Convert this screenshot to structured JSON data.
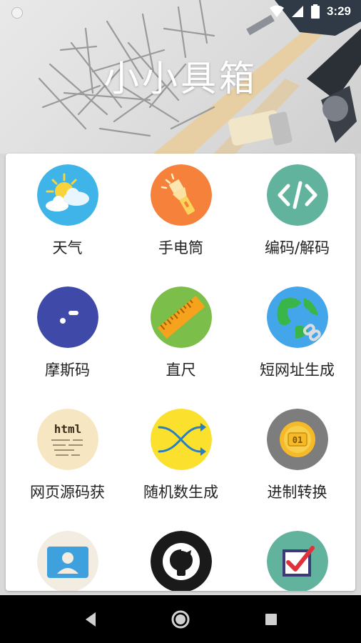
{
  "status_bar": {
    "time": "3:29"
  },
  "header": {
    "title": "小小具箱"
  },
  "tools": [
    {
      "label": "天气",
      "icon": "weather-icon",
      "color": "#3fb4e8"
    },
    {
      "label": "手电筒",
      "icon": "flashlight-icon",
      "color": "#f5813a"
    },
    {
      "label": "编码/解码",
      "icon": "code-icon",
      "color": "#62b39e"
    },
    {
      "label": "摩斯码",
      "icon": "morse-icon",
      "color": "#3f4aa8"
    },
    {
      "label": "直尺",
      "icon": "ruler-icon",
      "color": "#7cbe4a"
    },
    {
      "label": "短网址生成",
      "icon": "globe-link-icon",
      "color": "#43a6ea"
    },
    {
      "label": "网页源码获",
      "icon": "html-note-icon",
      "color": "#f7e6c2"
    },
    {
      "label": "随机数生成",
      "icon": "shuffle-icon",
      "color": "#fbe12e"
    },
    {
      "label": "进制转换",
      "icon": "binary-badge-icon",
      "color": "#7d7d7d"
    },
    {
      "label": "",
      "icon": "contact-card-icon",
      "color": "#f2ece1"
    },
    {
      "label": "",
      "icon": "github-icon",
      "color": "#1a1a1a"
    },
    {
      "label": "",
      "icon": "checkbox-icon",
      "color": "#62b39e"
    }
  ],
  "nav": {
    "back": "back-icon",
    "home": "home-icon",
    "recents": "recents-icon"
  }
}
